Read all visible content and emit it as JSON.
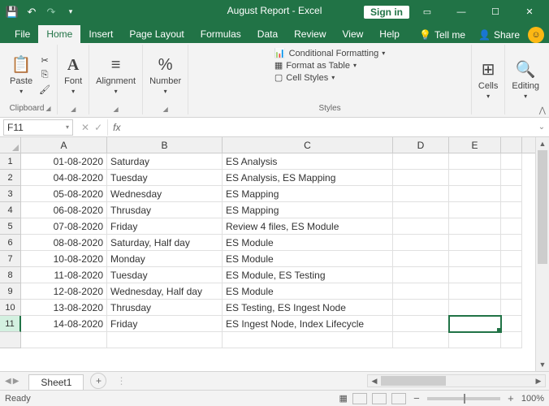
{
  "titlebar": {
    "title": "August Report  -  Excel",
    "signin": "Sign in"
  },
  "tabs": {
    "file": "File",
    "home": "Home",
    "insert": "Insert",
    "page_layout": "Page Layout",
    "formulas": "Formulas",
    "data": "Data",
    "review": "Review",
    "view": "View",
    "help": "Help",
    "tellme": "Tell me",
    "share": "Share"
  },
  "ribbon": {
    "paste": "Paste",
    "clipboard": "Clipboard",
    "font": "Font",
    "alignment": "Alignment",
    "number": "Number",
    "cond_fmt": "Conditional Formatting",
    "fmt_table": "Format as Table",
    "cell_styles": "Cell Styles",
    "styles": "Styles",
    "cells": "Cells",
    "editing": "Editing"
  },
  "namebox": "F11",
  "fx": "fx",
  "columns": [
    "A",
    "B",
    "C",
    "D",
    "E"
  ],
  "rows": [
    {
      "n": "1",
      "A": "01-08-2020",
      "B": "Saturday",
      "C": "ES Analysis"
    },
    {
      "n": "2",
      "A": "04-08-2020",
      "B": "Tuesday",
      "C": "ES Analysis, ES Mapping"
    },
    {
      "n": "3",
      "A": "05-08-2020",
      "B": "Wednesday",
      "C": "ES Mapping"
    },
    {
      "n": "4",
      "A": "06-08-2020",
      "B": "Thrusday",
      "C": "ES Mapping"
    },
    {
      "n": "5",
      "A": "07-08-2020",
      "B": "Friday",
      "C": "Review 4 files, ES Module"
    },
    {
      "n": "6",
      "A": "08-08-2020",
      "B": "Saturday, Half day",
      "C": "ES Module"
    },
    {
      "n": "7",
      "A": "10-08-2020",
      "B": "Monday",
      "C": "ES Module"
    },
    {
      "n": "8",
      "A": "11-08-2020",
      "B": "Tuesday",
      "C": "ES Module, ES Testing"
    },
    {
      "n": "9",
      "A": "12-08-2020",
      "B": "Wednesday, Half day",
      "C": "ES Module"
    },
    {
      "n": "10",
      "A": "13-08-2020",
      "B": "Thrusday",
      "C": "ES Testing, ES Ingest Node"
    },
    {
      "n": "11",
      "A": "14-08-2020",
      "B": "Friday",
      "C": "ES Ingest Node, Index Lifecycle"
    }
  ],
  "sheet": {
    "name": "Sheet1"
  },
  "status": {
    "ready": "Ready",
    "zoom": "100%"
  }
}
